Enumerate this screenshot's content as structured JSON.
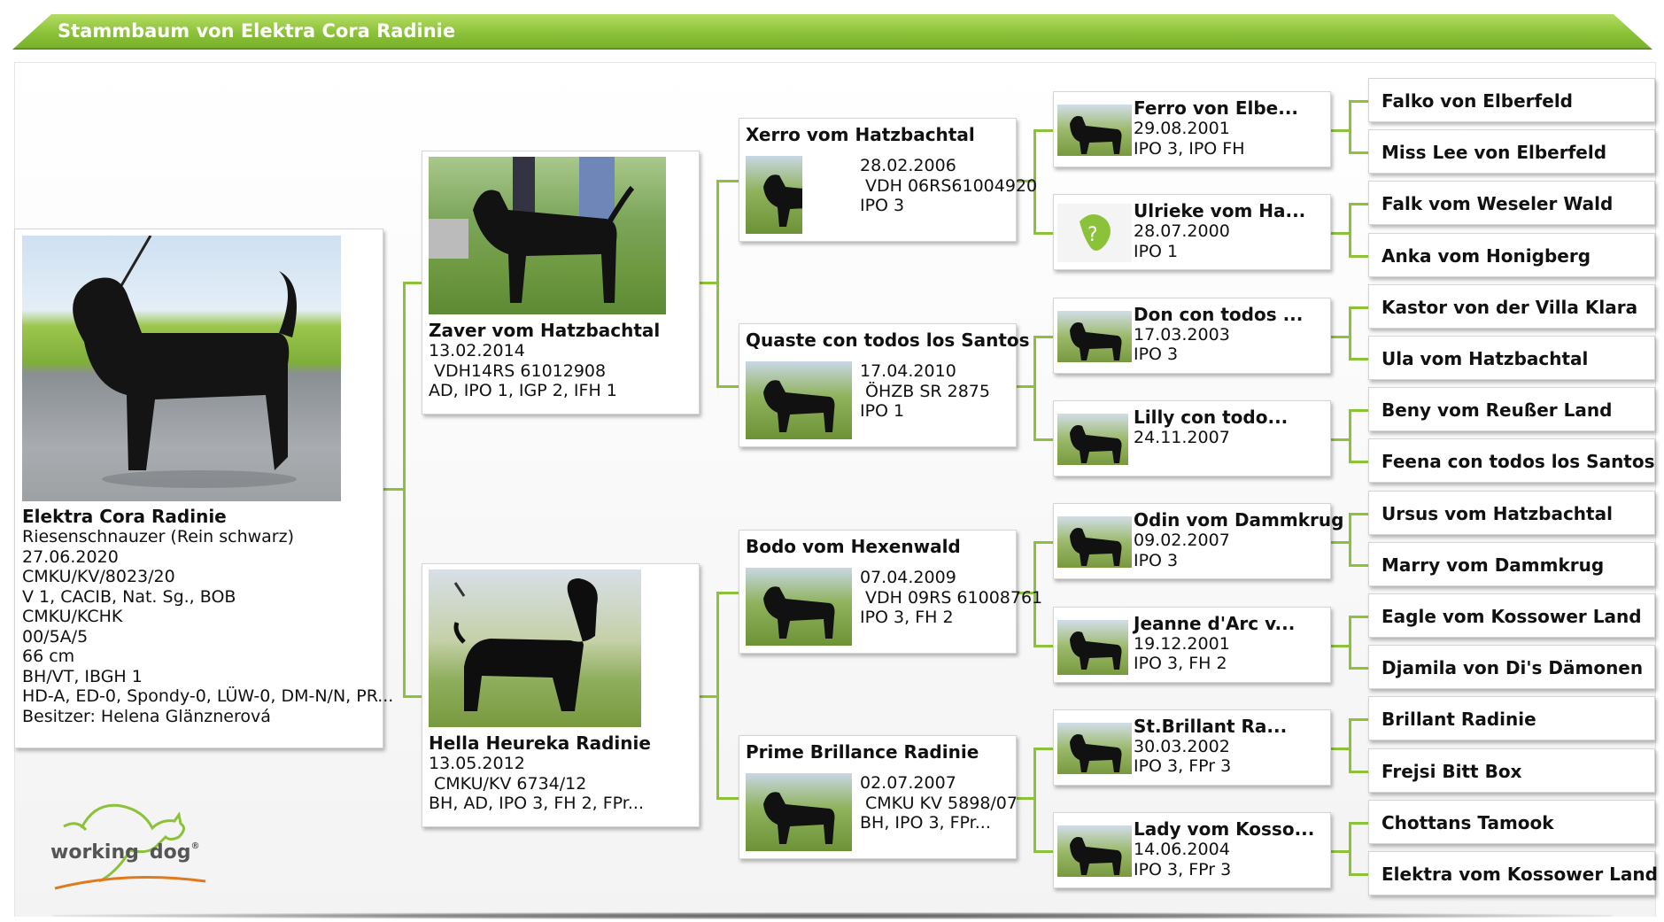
{
  "page": {
    "title": "Stammbaum von Elektra Cora Radinie"
  },
  "colors": {
    "accent": "#8cc23a",
    "card_border": "#d5d5d5",
    "logo_orange": "#e07a1f",
    "logo_gray": "#555555"
  },
  "subject": {
    "name": "Elektra Cora Radinie",
    "breed": "Riesenschnauzer (Rein schwarz)",
    "dob": "27.06.2020",
    "reg": "CMKU/KV/8023/20",
    "show": "V 1, CACIB, Nat. Sg., BOB",
    "club": "CMKU/KCHK",
    "code": "00/5A/5",
    "height": "66 cm",
    "titles": "BH/VT, IBGH 1",
    "health": "HD-A, ED-0, Spondy-0, LÜW-0, DM-N/N, PR...",
    "owner": "Besitzer: Helena Glänznerová"
  },
  "gen1": [
    {
      "name": "Zaver vom Hatzbachtal",
      "dob": "13.02.2014",
      "reg": "VDH14RS 61012908",
      "titles": "AD, IPO 1, IGP 2, IFH 1"
    },
    {
      "name": "Hella Heureka Radinie",
      "dob": "13.05.2012",
      "reg": "CMKU/KV 6734/12",
      "titles": "BH, AD, IPO 3, FH 2, FPr..."
    }
  ],
  "gen2": [
    {
      "name": "Xerro vom Hatzbachtal",
      "dob": "28.02.2006",
      "reg": "VDH 06RS61004920",
      "titles": "IPO 3"
    },
    {
      "name": "Quaste con todos los Santos",
      "dob": "17.04.2010",
      "reg": "ÖHZB SR 2875",
      "titles": "IPO 1"
    },
    {
      "name": "Bodo vom Hexenwald",
      "dob": "07.04.2009",
      "reg": "VDH 09RS 61008761",
      "titles": "IPO 3, FH 2"
    },
    {
      "name": "Prime Brillance Radinie",
      "dob": "02.07.2007",
      "reg": "CMKU KV 5898/07",
      "titles": "BH, IPO 3, FPr..."
    }
  ],
  "gen3": [
    {
      "name": "Ferro von Elbe...",
      "dob": "29.08.2001",
      "titles": "IPO 3, IPO FH",
      "icon": "dog-photo"
    },
    {
      "name": "Ulrieke vom Ha...",
      "dob": "28.07.2000",
      "titles": "IPO 1",
      "icon": "no-photo-icon"
    },
    {
      "name": "Don con todos ...",
      "dob": "17.03.2003",
      "titles": "IPO 3",
      "icon": "dog-photo"
    },
    {
      "name": "Lilly con todo...",
      "dob": "24.11.2007",
      "titles": "",
      "icon": "dog-photo"
    },
    {
      "name": "Odin vom Dammkrug",
      "dob": "09.02.2007",
      "titles": "IPO 3",
      "icon": "dog-photo"
    },
    {
      "name": "Jeanne d'Arc v...",
      "dob": "19.12.2001",
      "titles": "IPO 3, FH 2",
      "icon": "dog-photo"
    },
    {
      "name": "St.Brillant Ra...",
      "dob": "30.03.2002",
      "titles": "IPO 3, FPr 3",
      "icon": "dog-photo"
    },
    {
      "name": "Lady vom Kosso...",
      "dob": "14.06.2004",
      "titles": "IPO 3, FPr 3",
      "icon": "dog-photo"
    }
  ],
  "gen4": [
    "Falko von Elberfeld",
    "Miss Lee von Elberfeld",
    "Falk vom Weseler Wald",
    "Anka vom Honigberg",
    "Kastor von der Villa Klara",
    "Ula vom Hatzbachtal",
    "Beny vom Reußer Land",
    "Feena con todos los Santos",
    "Ursus vom Hatzbachtal",
    "Marry vom Dammkrug",
    "Eagle vom Kossower Land",
    "Djamila von Di's Dämonen",
    "Brillant Radinie",
    "Frejsi Bitt Box",
    "Chottans Tamook",
    "Elektra vom Kossower Land"
  ],
  "logo": {
    "word1": "working",
    "word2": "dog",
    "mark": "®"
  }
}
